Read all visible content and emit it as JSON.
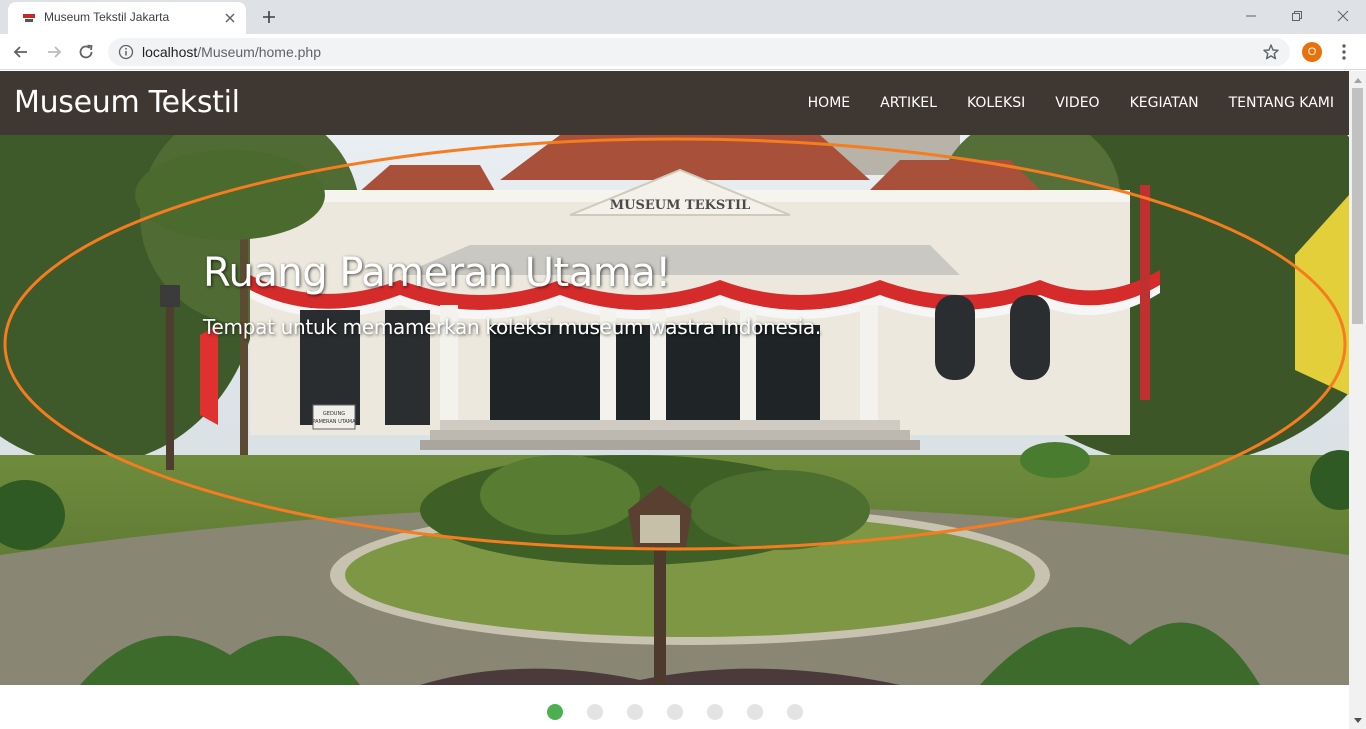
{
  "browser": {
    "tab_title": "Museum Tekstil Jakarta",
    "url_host": "localhost",
    "url_path": "/Museum/home.php",
    "profile_initial": "O",
    "icons": [
      "favicon",
      "close-icon",
      "plus-icon",
      "minimize-icon",
      "restore-icon",
      "window-close-icon",
      "back-arrow-icon",
      "forward-arrow-icon",
      "reload-icon",
      "info-icon",
      "star-icon",
      "more-vert-icon"
    ]
  },
  "site": {
    "brand": "Museum Tekstil",
    "nav": [
      "HOME",
      "ARTIKEL",
      "KOLEKSI",
      "VIDEO",
      "KEGIATAN",
      "TENTANG KAMI"
    ],
    "nav_bg": "#3f3731"
  },
  "slider": {
    "caption_title": "Ruang Pameran Utama!",
    "caption_text": "Tempat untuk memamerkan koleksi museum wastra Indonesia.",
    "building_sign": "MUSEUM TEKSTIL",
    "small_sign": "GEDUNG PAMERAN UTAMA",
    "slide_count": 7,
    "active_slide": 1,
    "active_color": "#4caf50",
    "highlight_color": "#f57c1f"
  }
}
